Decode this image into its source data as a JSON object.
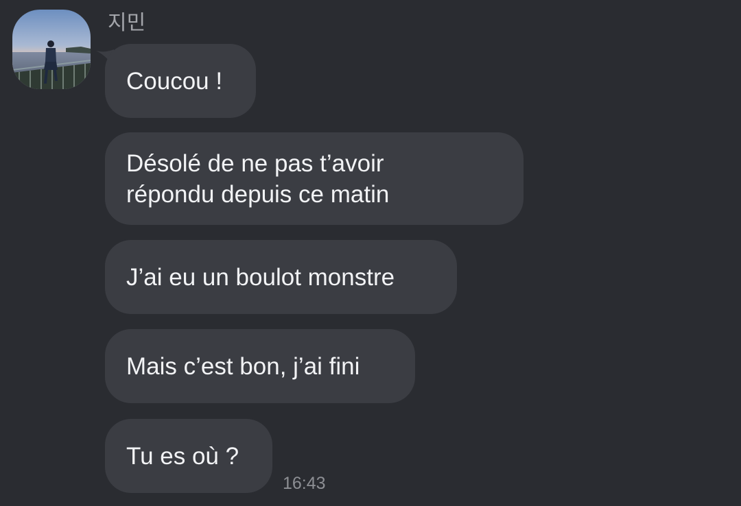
{
  "sender": {
    "name": "지민"
  },
  "messages": [
    {
      "text": "Coucou !"
    },
    {
      "text": "Désolé de ne pas t’avoir\nrépondu depuis ce matin"
    },
    {
      "text": "J’ai eu un boulot monstre"
    },
    {
      "text": "Mais c’est bon, j’ai fini"
    },
    {
      "text": "Tu es où ?"
    }
  ],
  "timestamp": "16:43",
  "colors": {
    "background": "#2a2c31",
    "bubble": "#3b3d43",
    "text": "#f2f3f5",
    "meta_text": "#8d8f94"
  },
  "icons": {
    "avatar": "profile-photo-seaside-sunset"
  }
}
